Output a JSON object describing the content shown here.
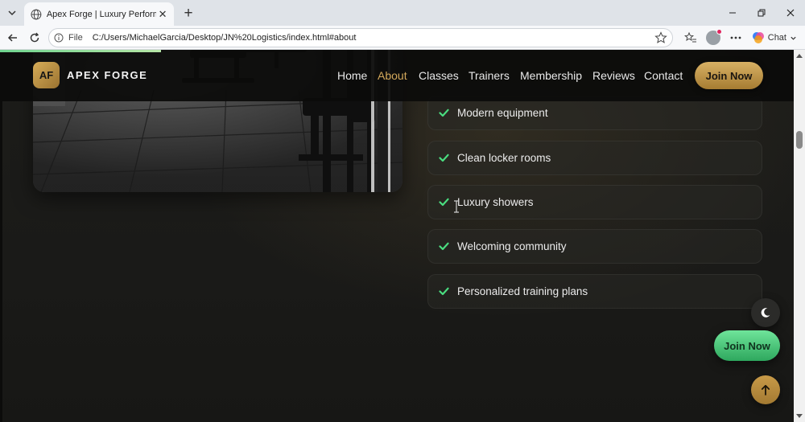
{
  "browser": {
    "tab_title": "Apex Forge | Luxury Performance",
    "url_prefix": "File",
    "url": "C:/Users/MichaelGarcia/Desktop/JN%20Logistics/index.html#about",
    "chat_label": "Chat",
    "new_tab_glyph": "+",
    "tab_close_glyph": "✕"
  },
  "page": {
    "scroll_progress_percent": 20,
    "scrollbar_position_percent": 21
  },
  "header": {
    "logo_initials": "AF",
    "logo_text": "APEX FORGE",
    "nav": [
      {
        "label": "Home",
        "active": false
      },
      {
        "label": "About",
        "active": true
      },
      {
        "label": "Classes",
        "active": false
      },
      {
        "label": "Trainers",
        "active": false
      },
      {
        "label": "Membership",
        "active": false
      },
      {
        "label": "Reviews",
        "active": false
      },
      {
        "label": "Contact",
        "active": false
      }
    ],
    "cta_label": "Join Now"
  },
  "about": {
    "image_icon": "gym-equipment-photo",
    "features": [
      {
        "label": "Modern equipment",
        "icon": "check-icon"
      },
      {
        "label": "Clean locker rooms",
        "icon": "check-icon"
      },
      {
        "label": "Luxury showers",
        "icon": "check-icon"
      },
      {
        "label": "Welcoming community",
        "icon": "check-icon"
      },
      {
        "label": "Personalized training plans",
        "icon": "check-icon"
      }
    ]
  },
  "floating": {
    "theme_icon": "moon-icon",
    "join_label": "Join Now",
    "back_to_top_icon": "arrow-up-icon"
  },
  "colors": {
    "accent_gold": "#d3a85b",
    "check_green": "#4ade80",
    "float_green": "#3fc774",
    "background": "#1a1a17"
  }
}
